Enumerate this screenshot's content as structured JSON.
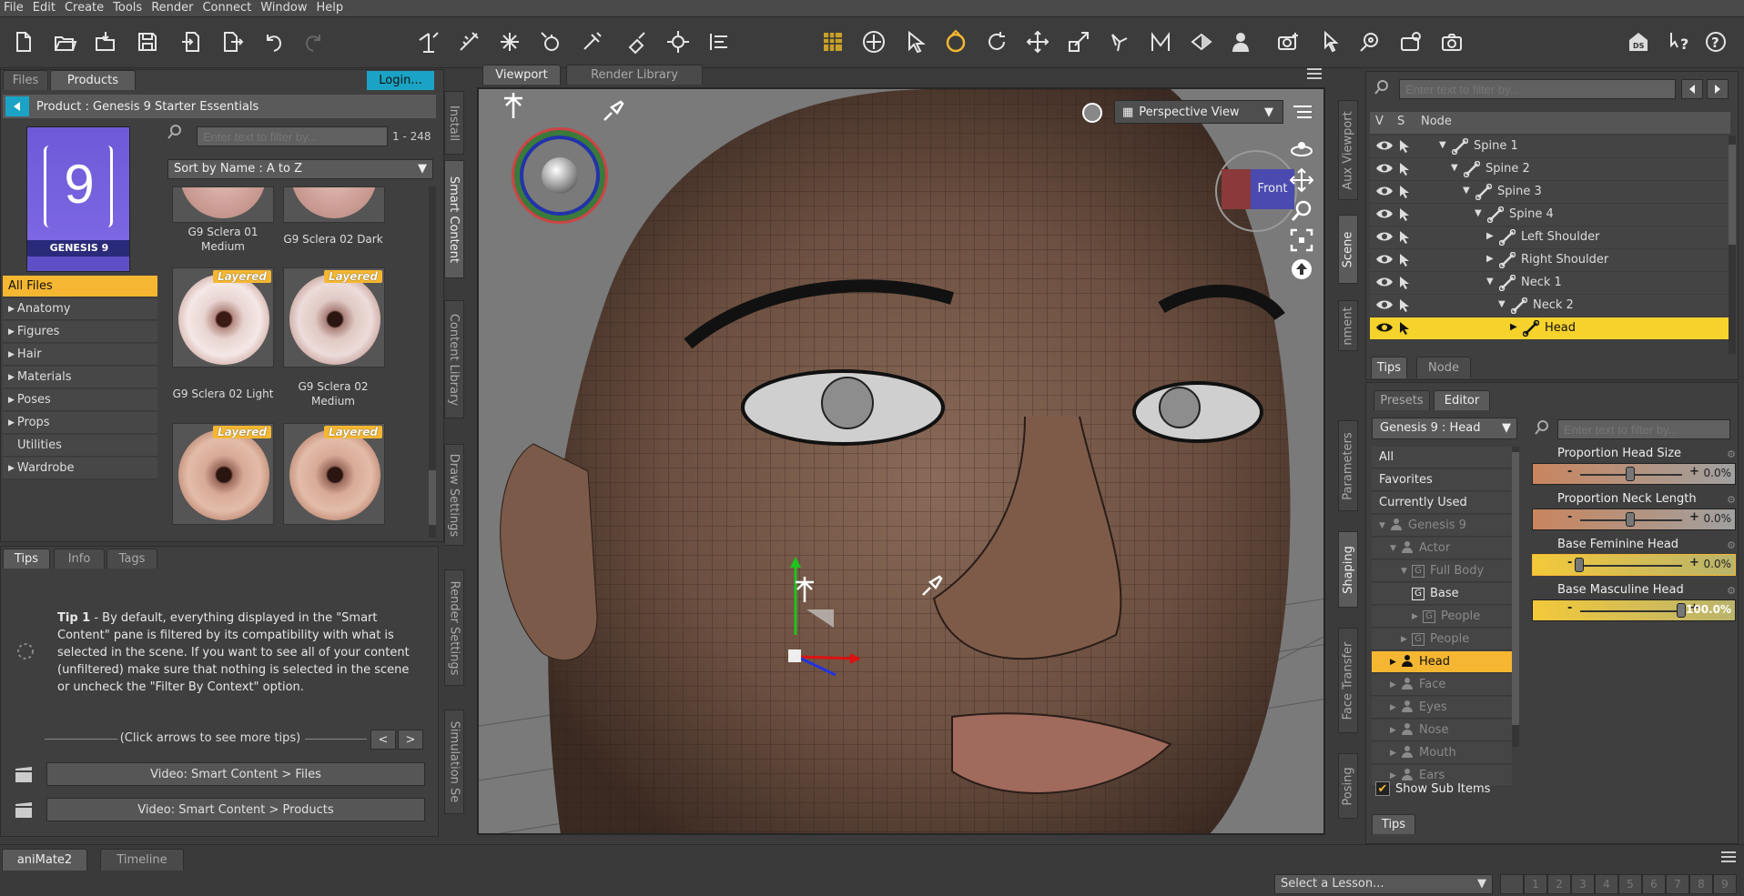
{
  "menu": [
    "File",
    "Edit",
    "Create",
    "Tools",
    "Render",
    "Connect",
    "Window",
    "Help"
  ],
  "left_tabs": {
    "files": "Files",
    "products": "Products",
    "login": "Login..."
  },
  "product_header": "Product :  Genesis 9 Starter Essentials",
  "product_thumb": {
    "number": "9",
    "caption": "GENESIS 9"
  },
  "filter_placeholder": "Enter text to filter by...",
  "result_count": "1 - 248",
  "sort_label": "Sort by Name : A to Z",
  "categories": [
    "All Files",
    "Anatomy",
    "Figures",
    "Hair",
    "Materials",
    "Poses",
    "Props",
    "Utilities",
    "Wardrobe"
  ],
  "thumbnails": [
    {
      "label": "G9 Sclera 01 Medium",
      "badge": ""
    },
    {
      "label": "G9 Sclera 02 Dark",
      "badge": ""
    },
    {
      "label": "G9 Sclera 02 Light",
      "badge": "Layered"
    },
    {
      "label": "G9 Sclera 02 Medium",
      "badge": "Layered"
    },
    {
      "label": "",
      "badge": "Layered"
    },
    {
      "label": "",
      "badge": "Layered"
    }
  ],
  "left_vtabs": [
    "Install",
    "Smart Content",
    "Content Library",
    "Draw Settings",
    "Render Settings",
    "Simulation Se"
  ],
  "tips_tabs": [
    "Tips",
    "Info",
    "Tags"
  ],
  "tip": {
    "title": "Tip 1",
    "text": " - By default, everything displayed in the \"Smart Content\" pane is filtered by its compatibility with what is selected in the scene. If you want to see all of your content (unfiltered) make sure that nothing is selected in the scene or uncheck the \"Filter By Context\" option.",
    "nav": "(Click arrows to see more tips)",
    "prev": "<",
    "next": ">"
  },
  "videos": [
    "Video: Smart Content > Files",
    "Video: Smart Content > Products"
  ],
  "viewport": {
    "tab": "Viewport",
    "render_tab": "Render Library",
    "view": "Perspective View",
    "cube_label": "Front"
  },
  "right_vtabs": [
    "Aux Viewport",
    "Scene",
    "nment",
    "Parameters",
    "Shaping",
    "Face Transfer",
    "Posing"
  ],
  "scene": {
    "filter": "Enter text to filter by...",
    "cols": [
      "V",
      "S",
      "Node"
    ],
    "nodes": [
      {
        "name": "Spine 1",
        "indent": 0,
        "arrow": "▼"
      },
      {
        "name": "Spine 2",
        "indent": 1,
        "arrow": "▼"
      },
      {
        "name": "Spine 3",
        "indent": 2,
        "arrow": "▼"
      },
      {
        "name": "Spine 4",
        "indent": 3,
        "arrow": "▼"
      },
      {
        "name": "Left Shoulder",
        "indent": 4,
        "arrow": "▶"
      },
      {
        "name": "Right Shoulder",
        "indent": 4,
        "arrow": "▶"
      },
      {
        "name": "Neck 1",
        "indent": 4,
        "arrow": "▼"
      },
      {
        "name": "Neck 2",
        "indent": 5,
        "arrow": "▼"
      },
      {
        "name": "Head",
        "indent": 6,
        "arrow": "▶",
        "selected": true
      }
    ],
    "sub_tabs": [
      "Tips",
      "Node"
    ]
  },
  "shaping": {
    "tabs": [
      "Presets",
      "Editor"
    ],
    "selector": "Genesis 9 : Head",
    "filter": "Enter text to filter by...",
    "groups": [
      {
        "label": "All",
        "level": 0,
        "arrow": "",
        "icon": "",
        "dim": false
      },
      {
        "label": "Favorites",
        "level": 0,
        "arrow": "",
        "icon": "",
        "dim": false
      },
      {
        "label": "Currently Used",
        "level": 0,
        "arrow": "",
        "icon": "",
        "dim": false
      },
      {
        "label": "Genesis 9",
        "level": 0,
        "arrow": "▼",
        "icon": "figure",
        "dim": true
      },
      {
        "label": "Actor",
        "level": 1,
        "arrow": "▼",
        "icon": "person",
        "dim": true
      },
      {
        "label": "Full Body",
        "level": 2,
        "arrow": "▼",
        "icon": "G",
        "dim": true
      },
      {
        "label": "Base",
        "level": 3,
        "arrow": "",
        "icon": "G",
        "dim": false
      },
      {
        "label": "People",
        "level": 3,
        "arrow": "▶",
        "icon": "G",
        "dim": true
      },
      {
        "label": "People",
        "level": 2,
        "arrow": "▶",
        "icon": "G",
        "dim": true
      },
      {
        "label": "Head",
        "level": 1,
        "arrow": "▶",
        "icon": "person",
        "dim": false,
        "selected": true
      },
      {
        "label": "Face",
        "level": 1,
        "arrow": "▶",
        "icon": "person",
        "dim": true
      },
      {
        "label": "Eyes",
        "level": 1,
        "arrow": "▶",
        "icon": "person",
        "dim": true
      },
      {
        "label": "Nose",
        "level": 1,
        "arrow": "▶",
        "icon": "person",
        "dim": true
      },
      {
        "label": "Mouth",
        "level": 1,
        "arrow": "▶",
        "icon": "person",
        "dim": true
      },
      {
        "label": "Ears",
        "level": 1,
        "arrow": "▶",
        "icon": "person",
        "dim": true
      }
    ],
    "show_sub_items": "Show Sub Items",
    "properties": [
      {
        "name": "Proportion Head Size",
        "value": "0.0%",
        "fraction": 0.5
      },
      {
        "name": "Proportion Neck Length",
        "value": "0.0%",
        "fraction": 0.5
      },
      {
        "name": "Base Feminine Head",
        "value": "0.0%",
        "fraction": 0.0
      },
      {
        "name": "Base Masculine Head",
        "value": "100.0%",
        "fraction": 1.0
      }
    ],
    "bottom_tab": "Tips"
  },
  "bottom": {
    "tabs": [
      "aniMate2",
      "Timeline"
    ],
    "lesson": "Select a Lesson...",
    "pages": [
      "1",
      "2",
      "3",
      "4",
      "5",
      "6",
      "7",
      "8",
      "9"
    ]
  },
  "colors": {
    "accent": "#f5b731",
    "selection": "#f5d22c",
    "login": "#1aa3c4"
  }
}
